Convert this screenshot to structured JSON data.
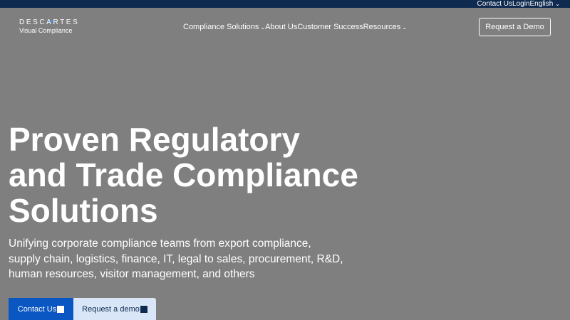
{
  "topbar": {
    "contact": "Contact Us",
    "login": "Login",
    "language": "English",
    "language_icon": "chevron-down-icon"
  },
  "logo": {
    "line1": "DESCARTES",
    "line2": "Visual Compliance",
    "colors": {
      "star": "#3d8fe0"
    }
  },
  "nav": {
    "items": [
      {
        "label": "Compliance Solutions",
        "has_dropdown": true
      },
      {
        "label": "About Us",
        "has_dropdown": false
      },
      {
        "label": "Customer Success",
        "has_dropdown": false
      },
      {
        "label": "Resources",
        "has_dropdown": true
      }
    ],
    "cta": "Request a Demo"
  },
  "hero": {
    "title_lines": [
      "Proven Regulatory",
      "and Trade Compliance",
      "Solutions"
    ],
    "subtitle_lines": [
      "Unifying corporate compliance teams from export compliance,",
      "supply chain, logistics, finance, IT, legal to sales, procurement, R&D,",
      "human resources, visitor management, and others"
    ],
    "buttons": {
      "contact": "Contact Us",
      "request": "Request a demo"
    }
  },
  "colors": {
    "background": "#7f7f7f",
    "topbar": "#0e2a4e",
    "primary_button": "#0a56c2",
    "secondary_button": "#d8e6f7",
    "text": "#ffffff"
  }
}
